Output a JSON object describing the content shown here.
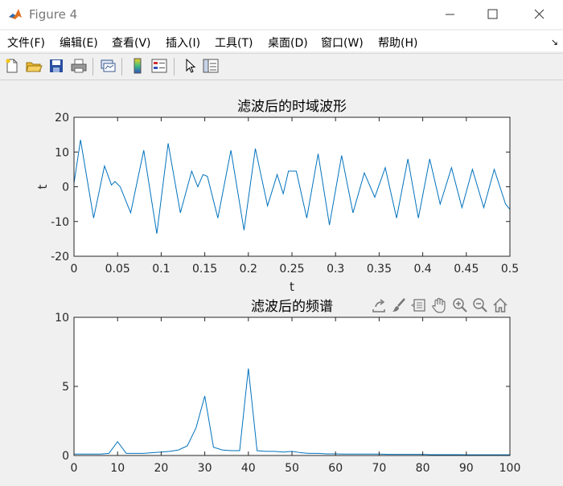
{
  "window": {
    "title": "Figure 4"
  },
  "menu": {
    "items": [
      "文件(F)",
      "编辑(E)",
      "查看(V)",
      "插入(I)",
      "工具(T)",
      "桌面(D)",
      "窗口(W)",
      "帮助(H)"
    ],
    "corner_icon": "↘"
  },
  "toolbar": {
    "icons": [
      "new-figure-icon",
      "open-file-icon",
      "save-icon",
      "print-icon",
      "link-plot-icon",
      "colorbar-icon",
      "legend-icon",
      "pointer-icon",
      "property-inspector-icon"
    ]
  },
  "axes_toolbar": {
    "icons": [
      "export-icon",
      "brush-icon",
      "data-tips-icon",
      "pan-icon",
      "zoom-in-icon",
      "zoom-out-icon",
      "home-icon"
    ]
  },
  "chart_data": [
    {
      "type": "line",
      "title": "滤波后的时域波形",
      "xlabel": "t",
      "ylabel": "t",
      "xlim": [
        0,
        0.5
      ],
      "ylim": [
        -20,
        20
      ],
      "xticks": [
        "0",
        "0.05",
        "0.1",
        "0.15",
        "0.2",
        "0.25",
        "0.3",
        "0.35",
        "0.4",
        "0.45",
        "0.5"
      ],
      "yticks": [
        "20",
        "10",
        "0",
        "-10",
        "-20"
      ],
      "color": "#0072bd",
      "grid": false,
      "series": [
        {
          "x": [
            0,
            0.0075,
            0.0225,
            0.035,
            0.043,
            0.047,
            0.053,
            0.065,
            0.08,
            0.095,
            0.108,
            0.122,
            0.135,
            0.142,
            0.148,
            0.153,
            0.165,
            0.18,
            0.195,
            0.208,
            0.222,
            0.233,
            0.24,
            0.246,
            0.255,
            0.267,
            0.28,
            0.293,
            0.307,
            0.32,
            0.333,
            0.345,
            0.357,
            0.37,
            0.383,
            0.395,
            0.408,
            0.42,
            0.433,
            0.445,
            0.457,
            0.47,
            0.482,
            0.495,
            0.5
          ],
          "y": [
            1,
            13.5,
            -9,
            6,
            0.5,
            1.5,
            0,
            -7.5,
            10.5,
            -13.5,
            12.5,
            -7.5,
            4.5,
            0,
            3.5,
            3,
            -9,
            10.5,
            -12.5,
            11,
            -5.5,
            3.5,
            -2,
            4.5,
            4.5,
            -9,
            9.5,
            -11,
            9,
            -7.5,
            4,
            -3,
            5.5,
            -9,
            8,
            -9,
            8,
            -5,
            5.5,
            -6,
            5,
            -6,
            5,
            -5,
            -6.5
          ]
        }
      ]
    },
    {
      "type": "line",
      "title": "滤波后的频谱",
      "xlabel": "",
      "ylabel": "",
      "xlim": [
        0,
        100
      ],
      "ylim": [
        0,
        10
      ],
      "xticks": [
        "0",
        "10",
        "20",
        "30",
        "40",
        "50",
        "60",
        "70",
        "80",
        "90",
        "100"
      ],
      "yticks": [
        "10",
        "5",
        "0"
      ],
      "color": "#0072bd",
      "grid": false,
      "series": [
        {
          "x": [
            0,
            2,
            4,
            6,
            8,
            10,
            12,
            14,
            16,
            18,
            20,
            22,
            24,
            26,
            28,
            30,
            32,
            34,
            36,
            38,
            40,
            42,
            44,
            46,
            48,
            50,
            52,
            54,
            56,
            58,
            60,
            62,
            64,
            66,
            68,
            70,
            72,
            74,
            76,
            78,
            80,
            82,
            84,
            86,
            88,
            90,
            92,
            94,
            96,
            98,
            100
          ],
          "y": [
            0.1,
            0.1,
            0.1,
            0.1,
            0.15,
            1.0,
            0.15,
            0.15,
            0.15,
            0.2,
            0.25,
            0.3,
            0.4,
            0.7,
            2.0,
            4.3,
            0.6,
            0.4,
            0.35,
            0.35,
            6.3,
            0.35,
            0.3,
            0.3,
            0.25,
            0.3,
            0.2,
            0.15,
            0.15,
            0.12,
            0.12,
            0.1,
            0.1,
            0.1,
            0.1,
            0.1,
            0.08,
            0.08,
            0.08,
            0.08,
            0.08,
            0.06,
            0.06,
            0.06,
            0.06,
            0.05,
            0.05,
            0.05,
            0.05,
            0.05,
            0.05
          ]
        }
      ]
    }
  ]
}
